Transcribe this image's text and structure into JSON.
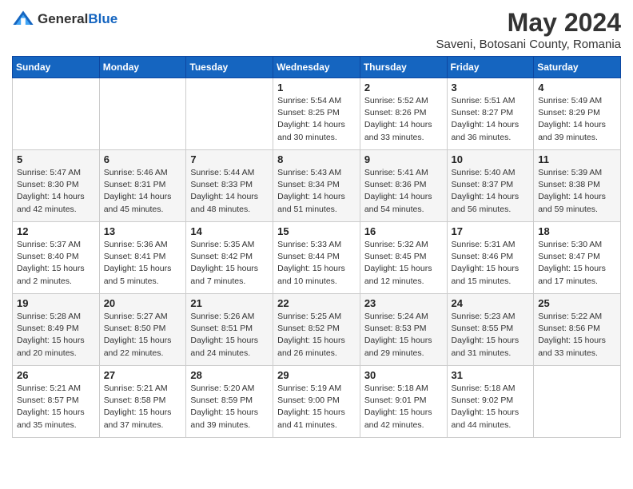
{
  "logo": {
    "text_general": "General",
    "text_blue": "Blue"
  },
  "title": "May 2024",
  "subtitle": "Saveni, Botosani County, Romania",
  "days_of_week": [
    "Sunday",
    "Monday",
    "Tuesday",
    "Wednesday",
    "Thursday",
    "Friday",
    "Saturday"
  ],
  "weeks": [
    [
      {
        "day": "",
        "sunrise": "",
        "sunset": "",
        "daylight": ""
      },
      {
        "day": "",
        "sunrise": "",
        "sunset": "",
        "daylight": ""
      },
      {
        "day": "",
        "sunrise": "",
        "sunset": "",
        "daylight": ""
      },
      {
        "day": "1",
        "sunrise": "Sunrise: 5:54 AM",
        "sunset": "Sunset: 8:25 PM",
        "daylight": "Daylight: 14 hours and 30 minutes."
      },
      {
        "day": "2",
        "sunrise": "Sunrise: 5:52 AM",
        "sunset": "Sunset: 8:26 PM",
        "daylight": "Daylight: 14 hours and 33 minutes."
      },
      {
        "day": "3",
        "sunrise": "Sunrise: 5:51 AM",
        "sunset": "Sunset: 8:27 PM",
        "daylight": "Daylight: 14 hours and 36 minutes."
      },
      {
        "day": "4",
        "sunrise": "Sunrise: 5:49 AM",
        "sunset": "Sunset: 8:29 PM",
        "daylight": "Daylight: 14 hours and 39 minutes."
      }
    ],
    [
      {
        "day": "5",
        "sunrise": "Sunrise: 5:47 AM",
        "sunset": "Sunset: 8:30 PM",
        "daylight": "Daylight: 14 hours and 42 minutes."
      },
      {
        "day": "6",
        "sunrise": "Sunrise: 5:46 AM",
        "sunset": "Sunset: 8:31 PM",
        "daylight": "Daylight: 14 hours and 45 minutes."
      },
      {
        "day": "7",
        "sunrise": "Sunrise: 5:44 AM",
        "sunset": "Sunset: 8:33 PM",
        "daylight": "Daylight: 14 hours and 48 minutes."
      },
      {
        "day": "8",
        "sunrise": "Sunrise: 5:43 AM",
        "sunset": "Sunset: 8:34 PM",
        "daylight": "Daylight: 14 hours and 51 minutes."
      },
      {
        "day": "9",
        "sunrise": "Sunrise: 5:41 AM",
        "sunset": "Sunset: 8:36 PM",
        "daylight": "Daylight: 14 hours and 54 minutes."
      },
      {
        "day": "10",
        "sunrise": "Sunrise: 5:40 AM",
        "sunset": "Sunset: 8:37 PM",
        "daylight": "Daylight: 14 hours and 56 minutes."
      },
      {
        "day": "11",
        "sunrise": "Sunrise: 5:39 AM",
        "sunset": "Sunset: 8:38 PM",
        "daylight": "Daylight: 14 hours and 59 minutes."
      }
    ],
    [
      {
        "day": "12",
        "sunrise": "Sunrise: 5:37 AM",
        "sunset": "Sunset: 8:40 PM",
        "daylight": "Daylight: 15 hours and 2 minutes."
      },
      {
        "day": "13",
        "sunrise": "Sunrise: 5:36 AM",
        "sunset": "Sunset: 8:41 PM",
        "daylight": "Daylight: 15 hours and 5 minutes."
      },
      {
        "day": "14",
        "sunrise": "Sunrise: 5:35 AM",
        "sunset": "Sunset: 8:42 PM",
        "daylight": "Daylight: 15 hours and 7 minutes."
      },
      {
        "day": "15",
        "sunrise": "Sunrise: 5:33 AM",
        "sunset": "Sunset: 8:44 PM",
        "daylight": "Daylight: 15 hours and 10 minutes."
      },
      {
        "day": "16",
        "sunrise": "Sunrise: 5:32 AM",
        "sunset": "Sunset: 8:45 PM",
        "daylight": "Daylight: 15 hours and 12 minutes."
      },
      {
        "day": "17",
        "sunrise": "Sunrise: 5:31 AM",
        "sunset": "Sunset: 8:46 PM",
        "daylight": "Daylight: 15 hours and 15 minutes."
      },
      {
        "day": "18",
        "sunrise": "Sunrise: 5:30 AM",
        "sunset": "Sunset: 8:47 PM",
        "daylight": "Daylight: 15 hours and 17 minutes."
      }
    ],
    [
      {
        "day": "19",
        "sunrise": "Sunrise: 5:28 AM",
        "sunset": "Sunset: 8:49 PM",
        "daylight": "Daylight: 15 hours and 20 minutes."
      },
      {
        "day": "20",
        "sunrise": "Sunrise: 5:27 AM",
        "sunset": "Sunset: 8:50 PM",
        "daylight": "Daylight: 15 hours and 22 minutes."
      },
      {
        "day": "21",
        "sunrise": "Sunrise: 5:26 AM",
        "sunset": "Sunset: 8:51 PM",
        "daylight": "Daylight: 15 hours and 24 minutes."
      },
      {
        "day": "22",
        "sunrise": "Sunrise: 5:25 AM",
        "sunset": "Sunset: 8:52 PM",
        "daylight": "Daylight: 15 hours and 26 minutes."
      },
      {
        "day": "23",
        "sunrise": "Sunrise: 5:24 AM",
        "sunset": "Sunset: 8:53 PM",
        "daylight": "Daylight: 15 hours and 29 minutes."
      },
      {
        "day": "24",
        "sunrise": "Sunrise: 5:23 AM",
        "sunset": "Sunset: 8:55 PM",
        "daylight": "Daylight: 15 hours and 31 minutes."
      },
      {
        "day": "25",
        "sunrise": "Sunrise: 5:22 AM",
        "sunset": "Sunset: 8:56 PM",
        "daylight": "Daylight: 15 hours and 33 minutes."
      }
    ],
    [
      {
        "day": "26",
        "sunrise": "Sunrise: 5:21 AM",
        "sunset": "Sunset: 8:57 PM",
        "daylight": "Daylight: 15 hours and 35 minutes."
      },
      {
        "day": "27",
        "sunrise": "Sunrise: 5:21 AM",
        "sunset": "Sunset: 8:58 PM",
        "daylight": "Daylight: 15 hours and 37 minutes."
      },
      {
        "day": "28",
        "sunrise": "Sunrise: 5:20 AM",
        "sunset": "Sunset: 8:59 PM",
        "daylight": "Daylight: 15 hours and 39 minutes."
      },
      {
        "day": "29",
        "sunrise": "Sunrise: 5:19 AM",
        "sunset": "Sunset: 9:00 PM",
        "daylight": "Daylight: 15 hours and 41 minutes."
      },
      {
        "day": "30",
        "sunrise": "Sunrise: 5:18 AM",
        "sunset": "Sunset: 9:01 PM",
        "daylight": "Daylight: 15 hours and 42 minutes."
      },
      {
        "day": "31",
        "sunrise": "Sunrise: 5:18 AM",
        "sunset": "Sunset: 9:02 PM",
        "daylight": "Daylight: 15 hours and 44 minutes."
      },
      {
        "day": "",
        "sunrise": "",
        "sunset": "",
        "daylight": ""
      }
    ]
  ]
}
